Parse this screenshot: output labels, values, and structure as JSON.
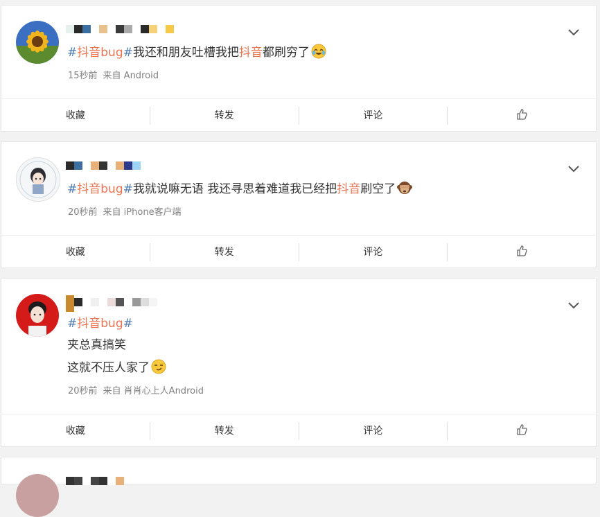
{
  "posts": [
    {
      "segments": [
        "#",
        "抖音bug",
        "#",
        "我还和朋友吐槽我把",
        "抖音",
        "都刷穷了"
      ],
      "emoji": "laughing-crying-emoji",
      "time": "15秒前",
      "source": "来自 Android"
    },
    {
      "segments": [
        "#",
        "抖音bug",
        "#",
        "我就说嘛无语 我还寻思着难道我已经把",
        "抖音",
        "刷空了"
      ],
      "emoji": "see-no-evil-monkey-emoji",
      "time": "20秒前",
      "source": "来自 iPhone客户端"
    },
    {
      "segments": [
        "#",
        "抖音bug",
        "#"
      ],
      "line2": "夹总真搞笑",
      "line3": "这就不压人家了",
      "emoji": "smirk-face-emoji",
      "time": "20秒前",
      "source": "来自 肖肖心上人Android"
    }
  ],
  "actions": {
    "collect": "收藏",
    "repost": "转发",
    "comment": "评论"
  },
  "colors": {
    "topic_link": "#507daf",
    "keyword": "#eb7350",
    "meta": "#808080"
  }
}
